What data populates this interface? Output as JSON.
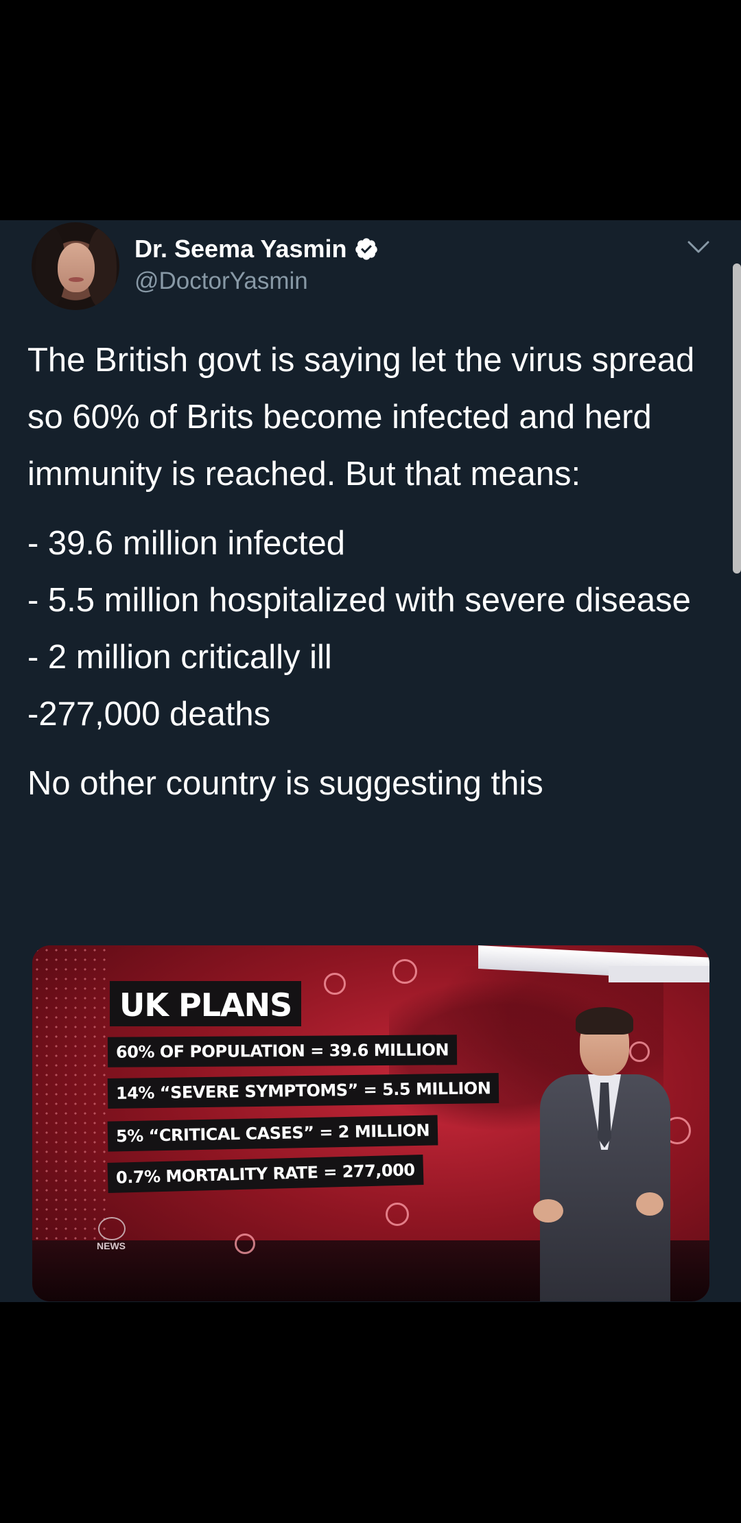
{
  "tweet": {
    "author_name": "Dr. Seema Yasmin",
    "handle": "@DoctorYasmin",
    "verified": true,
    "paragraphs": [
      "The British govt is saying let the virus spread so 60% of Brits become infected and herd immunity is reached. But that means:",
      "- 39.6 million infected",
      "- 5.5 million hospitalized with severe disease",
      "- 2 million critically ill",
      "-277,000 deaths",
      "No other country is suggesting this"
    ]
  },
  "media": {
    "panel_title": "UK PLANS",
    "rows": [
      "60% OF POPULATION = 39.6 MILLION",
      "14% “SEVERE SYMPTOMS” = 5.5 MILLION",
      "5% “CRITICAL CASES” = 2 MILLION",
      "0.7% MORTALITY RATE = 277,000"
    ],
    "logo_text": "NEWS"
  },
  "icons": {
    "verified": "verified-badge-icon",
    "menu": "chevron-down-icon"
  },
  "colors": {
    "background": "#000000",
    "tweet_bg": "#15202b",
    "secondary_text": "#8899a6"
  }
}
